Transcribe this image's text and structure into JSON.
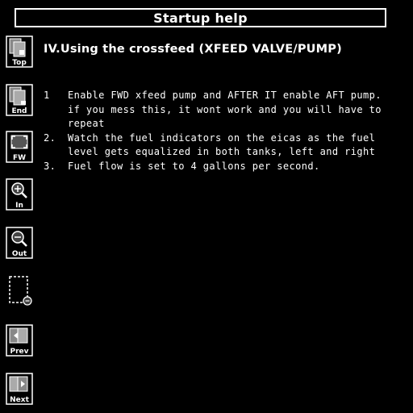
{
  "window": {
    "title": "Startup help"
  },
  "toolbar": {
    "top_label": "Top",
    "end_label": "End",
    "fw_label": "FW",
    "in_label": "In",
    "out_label": "Out",
    "prev_label": "Prev",
    "next_label": "Next",
    "icons": {
      "top": "page-top-icon",
      "end": "page-end-icon",
      "fw": "fit-width-icon",
      "in": "zoom-in-icon",
      "out": "zoom-out-icon",
      "zoom_area": "zoom-area-icon",
      "prev": "previous-page-icon",
      "next": "next-page-icon"
    }
  },
  "content": {
    "heading": "IV.Using the crossfeed (XFEED VALVE/PUMP)",
    "steps": [
      {
        "num": "1",
        "text": "Enable FWD xfeed pump and AFTER IT enable AFT pump. if you mess this, it wont work and you will have to repeat"
      },
      {
        "num": "2.",
        "text": "Watch the fuel indicators on the eicas as the fuel level gets equalized in both tanks, left and right"
      },
      {
        "num": "3.",
        "text": "Fuel flow is set to 4 gallons per second."
      }
    ]
  },
  "colors": {
    "background": "#000000",
    "foreground": "#ffffff",
    "icon_gray": "#9a9a9a"
  }
}
